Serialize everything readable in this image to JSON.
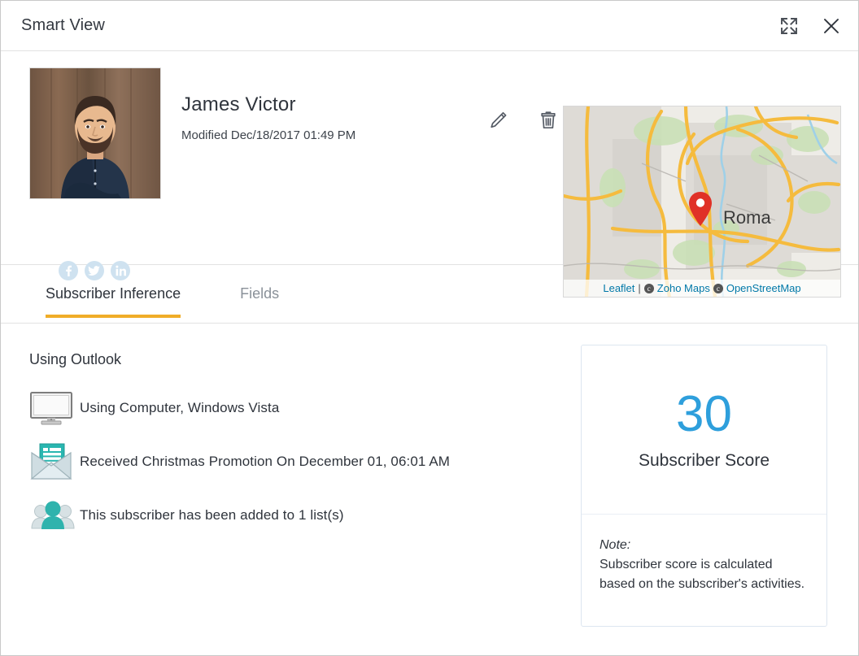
{
  "window": {
    "title": "Smart View",
    "expand_icon": "expand-arrows-icon",
    "close_icon": "close-icon"
  },
  "profile": {
    "name": "James Victor",
    "modified": "Modified Dec/18/2017 01:49 PM",
    "avatar_alt": "subscriber-photo",
    "social": [
      {
        "name": "facebook-icon",
        "glyph": "f"
      },
      {
        "name": "twitter-icon",
        "glyph": "t"
      },
      {
        "name": "linkedin-icon",
        "glyph": "in"
      }
    ],
    "actions": [
      {
        "name": "edit-icon",
        "label": "Edit"
      },
      {
        "name": "delete-icon",
        "label": "Delete"
      }
    ]
  },
  "map": {
    "place_label": "Roma",
    "marker": "map-pin-icon",
    "attribution": {
      "leaflet": "Leaflet",
      "separator": "|",
      "zoho": "Zoho Maps",
      "osm": "OpenStreetMap",
      "cc_glyph": "c"
    }
  },
  "tabs": [
    {
      "label": "Subscriber Inference",
      "active": true
    },
    {
      "label": "Fields",
      "active": false
    }
  ],
  "inference": {
    "heading": "Using Outlook",
    "rows": [
      {
        "icon": "monitor-icon",
        "text": "Using Computer, Windows Vista"
      },
      {
        "icon": "newsletter-envelope-icon",
        "text": "Received Christmas Promotion On December 01, 06:01 AM"
      },
      {
        "icon": "people-group-icon",
        "text": "This subscriber has been added to 1 list(s)"
      }
    ]
  },
  "score_card": {
    "value": "30",
    "label": "Subscriber Score",
    "note_title": "Note:",
    "note_text": "Subscriber score is calculated based on the subscriber's activities."
  },
  "colors": {
    "accent_tab": "#f0ad28",
    "score_blue": "#2e9fdc",
    "teal": "#3fbfb9",
    "link_blue": "#0078a8"
  }
}
